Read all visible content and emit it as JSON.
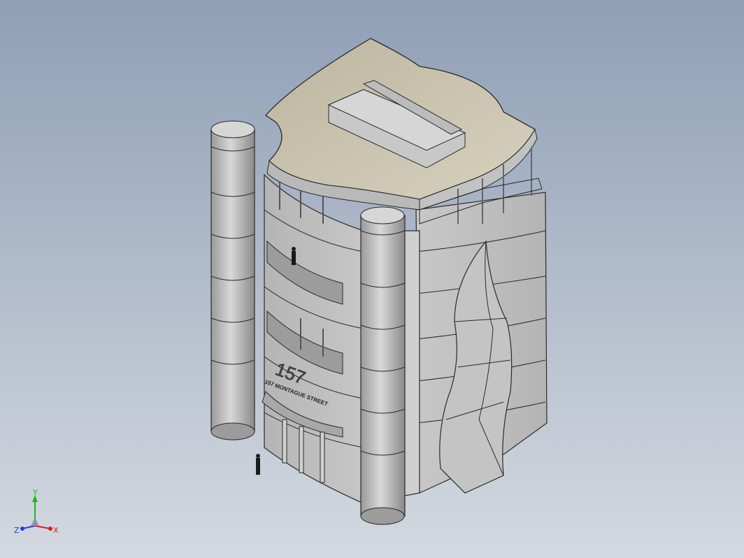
{
  "viewport": {
    "background_top": "#8f9fb6",
    "background_bottom": "#d4d9e0"
  },
  "model": {
    "building_number": "157",
    "street_sign": "157 MONTAGUE STREET",
    "colors": {
      "wall": "#c9c9c9",
      "wall_shade": "#a9a9a9",
      "roof": "#c7c0a6",
      "edge": "#2a2a2a",
      "glass": "#b8bcc2"
    }
  },
  "triad": {
    "x_label": "X",
    "y_label": "Y",
    "z_label": "Z",
    "x_color": "#d42020",
    "y_color": "#18b818",
    "z_color": "#2040d8"
  }
}
